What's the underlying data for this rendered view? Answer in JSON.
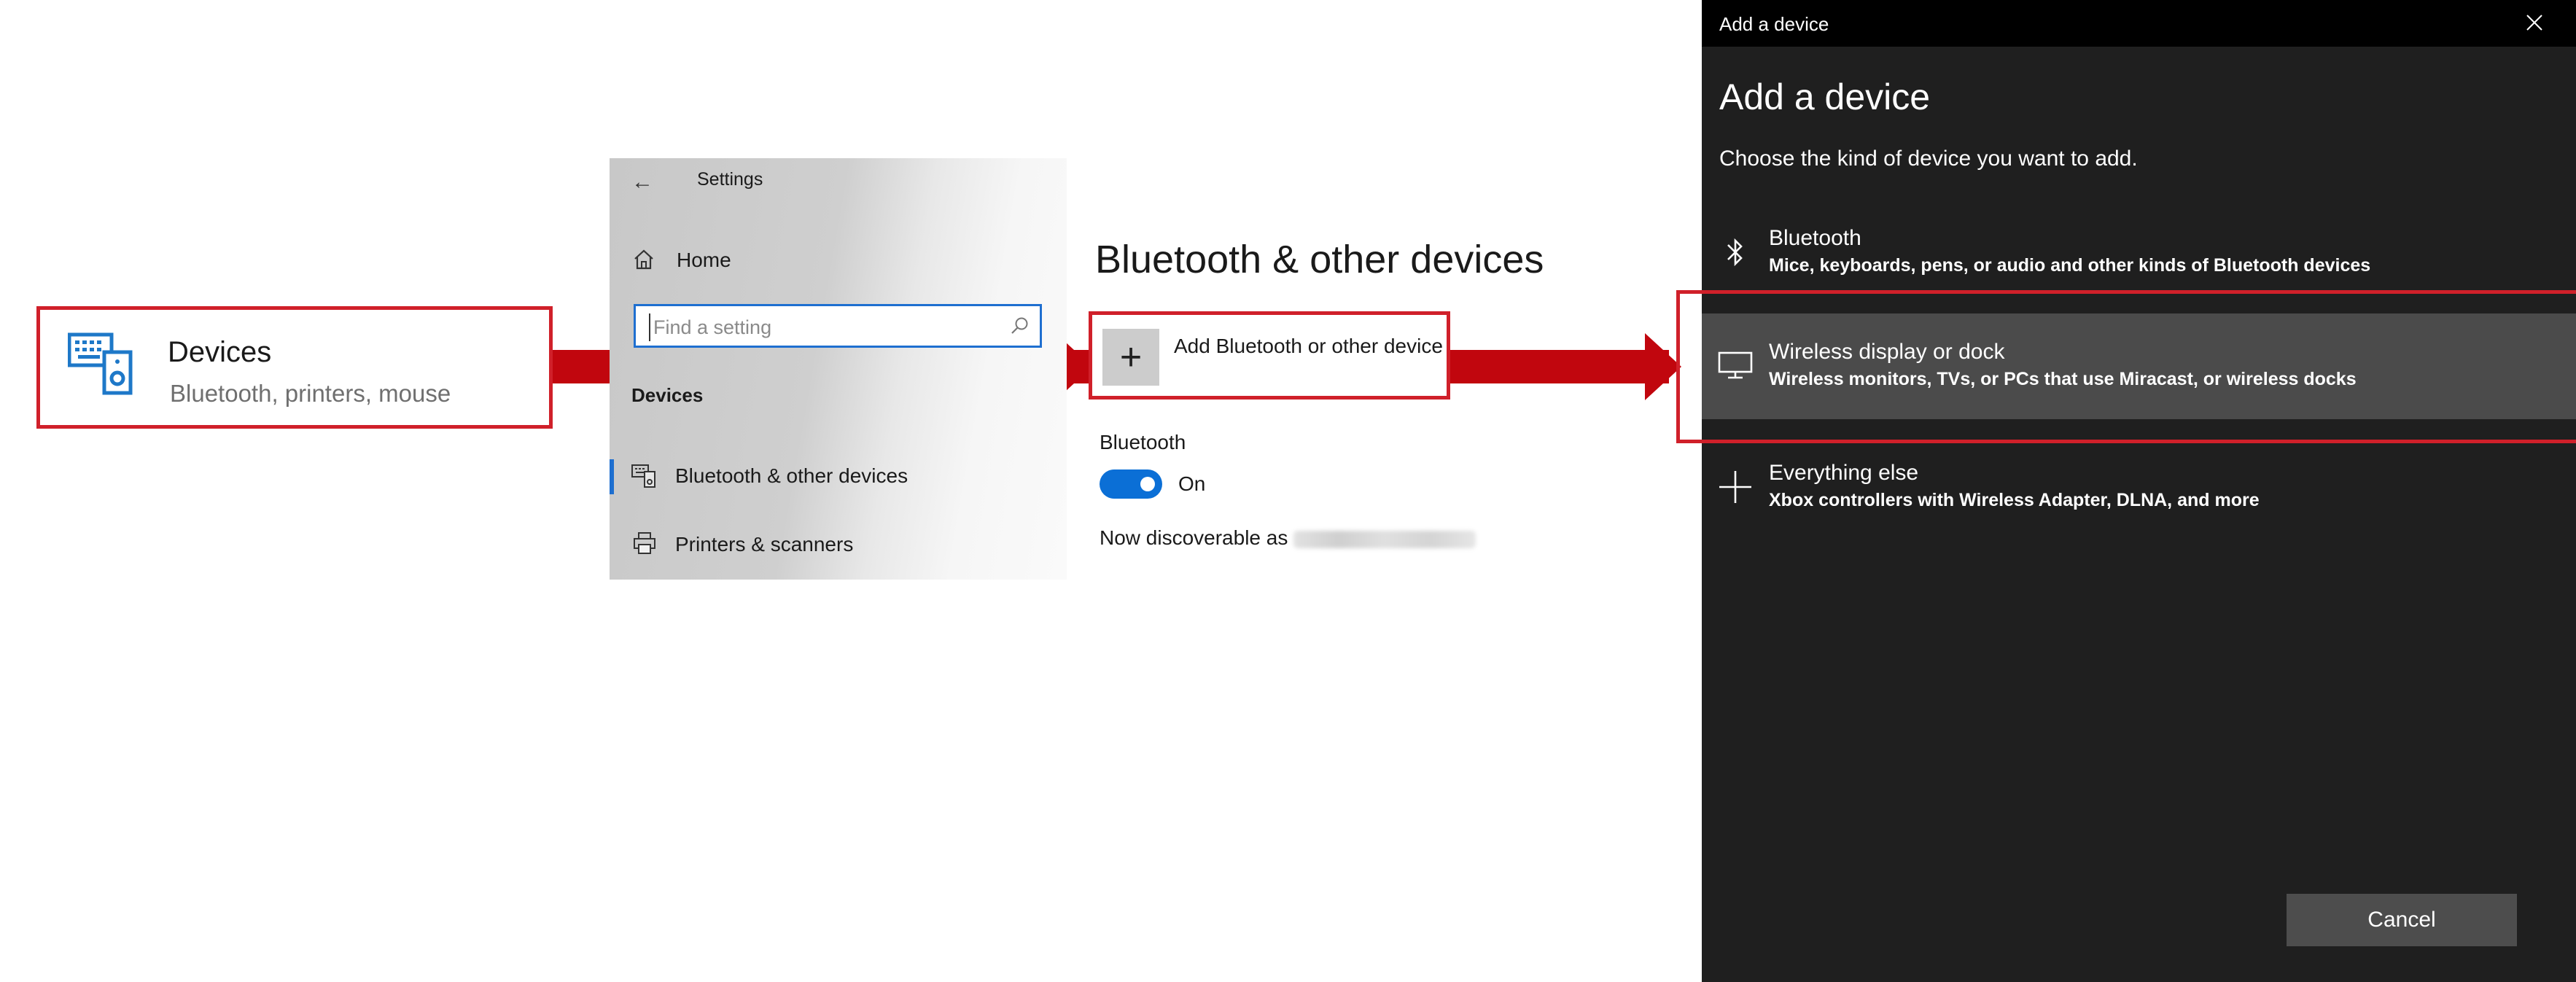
{
  "tile": {
    "title": "Devices",
    "subtitle": "Bluetooth, printers, mouse",
    "icon": "devices-icon"
  },
  "settings": {
    "title": "Settings",
    "home_label": "Home",
    "search_placeholder": "Find a setting",
    "section_label": "Devices",
    "nav_items": [
      {
        "label": "Bluetooth & other devices",
        "icon": "bluetooth-devices-icon",
        "selected": true
      },
      {
        "label": "Printers & scanners",
        "icon": "printer-icon",
        "selected": false
      }
    ]
  },
  "bt_page": {
    "title": "Bluetooth & other devices",
    "add_label": "Add Bluetooth or other device",
    "bluetooth_heading": "Bluetooth",
    "toggle_label": "On",
    "discoverable_prefix": "Now discoverable as"
  },
  "dialog": {
    "bar_title": "Add a device",
    "heading": "Add a device",
    "subtitle": "Choose the kind of device you want to add.",
    "options": [
      {
        "title": "Bluetooth",
        "desc": "Mice, keyboards, pens, or audio and other kinds of Bluetooth devices",
        "icon": "bluetooth-icon"
      },
      {
        "title": "Wireless display or dock",
        "desc": "Wireless monitors, TVs, or PCs that use Miracast, or wireless docks",
        "icon": "monitor-icon"
      },
      {
        "title": "Everything else",
        "desc": "Xbox controllers with Wireless Adapter, DLNA, and more",
        "icon": "plus-icon"
      }
    ],
    "cancel_label": "Cancel"
  },
  "colors": {
    "highlight_red": "#d0202a",
    "arrow_red": "#c1060e",
    "accent_blue": "#0b6fd6",
    "dialog_bg": "#1f1f1f",
    "selected_option_bg": "#4b4b4b"
  }
}
